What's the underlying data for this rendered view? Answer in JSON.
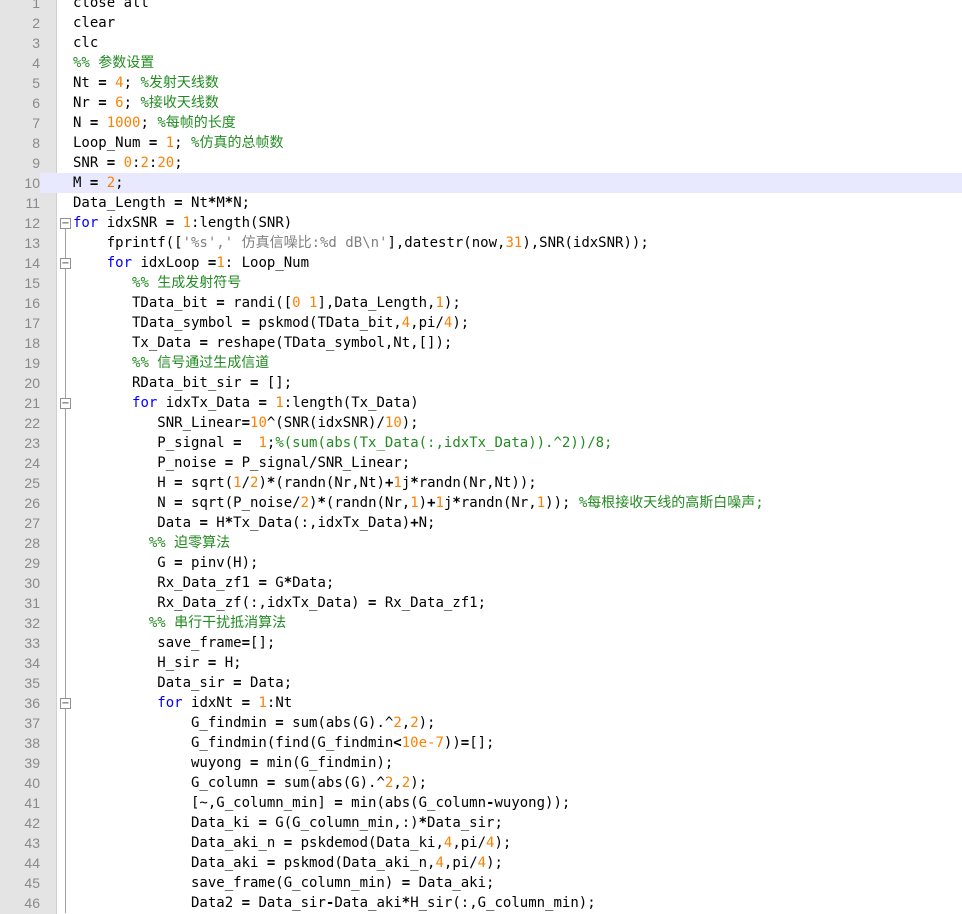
{
  "editor": {
    "highlight_line": 10,
    "colors": {
      "background": "#ffffff",
      "gutter": "#e4e4e4",
      "current_line": "#e8e8ff",
      "keyword": "#0000ff",
      "comment": "#228b22",
      "number": "#ff8000",
      "string": "#808080",
      "line_number": "#8a8a8a"
    },
    "lines": [
      {
        "n": "1",
        "fold": "",
        "tokens": [
          [
            "t",
            "close all"
          ]
        ]
      },
      {
        "n": "2",
        "fold": "",
        "tokens": [
          [
            "t",
            "clear"
          ]
        ]
      },
      {
        "n": "3",
        "fold": "",
        "tokens": [
          [
            "t",
            "clc"
          ]
        ]
      },
      {
        "n": "4",
        "fold": "",
        "tokens": [
          [
            "c",
            "%% 参数设置"
          ]
        ]
      },
      {
        "n": "5",
        "fold": "",
        "tokens": [
          [
            "t",
            "Nt "
          ],
          [
            "o",
            "="
          ],
          [
            "t",
            " "
          ],
          [
            "n",
            "4"
          ],
          [
            "t",
            "; "
          ],
          [
            "c",
            "%发射天线数"
          ]
        ]
      },
      {
        "n": "6",
        "fold": "",
        "tokens": [
          [
            "t",
            "Nr "
          ],
          [
            "o",
            "="
          ],
          [
            "t",
            " "
          ],
          [
            "n",
            "6"
          ],
          [
            "t",
            "; "
          ],
          [
            "c",
            "%接收天线数"
          ]
        ]
      },
      {
        "n": "7",
        "fold": "",
        "tokens": [
          [
            "t",
            "N "
          ],
          [
            "o",
            "="
          ],
          [
            "t",
            " "
          ],
          [
            "n",
            "1000"
          ],
          [
            "t",
            "; "
          ],
          [
            "c",
            "%每帧的长度"
          ]
        ]
      },
      {
        "n": "8",
        "fold": "",
        "tokens": [
          [
            "t",
            "Loop_Num "
          ],
          [
            "o",
            "="
          ],
          [
            "t",
            " "
          ],
          [
            "n",
            "1"
          ],
          [
            "t",
            "; "
          ],
          [
            "c",
            "%仿真的总帧数"
          ]
        ]
      },
      {
        "n": "9",
        "fold": "",
        "tokens": [
          [
            "t",
            "SNR "
          ],
          [
            "o",
            "="
          ],
          [
            "t",
            " "
          ],
          [
            "n",
            "0"
          ],
          [
            "t",
            ":"
          ],
          [
            "n",
            "2"
          ],
          [
            "t",
            ":"
          ],
          [
            "n",
            "20"
          ],
          [
            "t",
            ";"
          ]
        ]
      },
      {
        "n": "10",
        "fold": "",
        "tokens": [
          [
            "t",
            "M "
          ],
          [
            "o",
            "="
          ],
          [
            "t",
            " "
          ],
          [
            "n",
            "2"
          ],
          [
            "t",
            ";"
          ]
        ]
      },
      {
        "n": "11",
        "fold": "",
        "tokens": [
          [
            "t",
            "Data_Length "
          ],
          [
            "o",
            "="
          ],
          [
            "t",
            " Nt"
          ],
          [
            "o",
            "*"
          ],
          [
            "t",
            "M"
          ],
          [
            "o",
            "*"
          ],
          [
            "t",
            "N;"
          ]
        ]
      },
      {
        "n": "12",
        "fold": "open-top",
        "tokens": [
          [
            "k",
            "for"
          ],
          [
            "t",
            " idxSNR "
          ],
          [
            "o",
            "="
          ],
          [
            "t",
            " "
          ],
          [
            "n",
            "1"
          ],
          [
            "t",
            ":length(SNR)"
          ]
        ]
      },
      {
        "n": "13",
        "fold": "line",
        "tokens": [
          [
            "t",
            "    fprintf(["
          ],
          [
            "s",
            "'%s',' 仿真信噪比:%d dB\\n'"
          ],
          [
            "t",
            "],datestr(now,"
          ],
          [
            "n",
            "31"
          ],
          [
            "t",
            "),SNR(idxSNR));"
          ]
        ]
      },
      {
        "n": "14",
        "fold": "open",
        "tokens": [
          [
            "t",
            "    "
          ],
          [
            "k",
            "for"
          ],
          [
            "t",
            " idxLoop "
          ],
          [
            "o",
            "="
          ],
          [
            "n",
            "1"
          ],
          [
            "t",
            ": Loop_Num"
          ]
        ]
      },
      {
        "n": "15",
        "fold": "line",
        "tokens": [
          [
            "t",
            "       "
          ],
          [
            "c",
            "%% 生成发射符号"
          ]
        ]
      },
      {
        "n": "16",
        "fold": "line",
        "tokens": [
          [
            "t",
            "       TData_bit "
          ],
          [
            "o",
            "="
          ],
          [
            "t",
            " randi(["
          ],
          [
            "n",
            "0 1"
          ],
          [
            "t",
            "],Data_Length,"
          ],
          [
            "n",
            "1"
          ],
          [
            "t",
            ");"
          ]
        ]
      },
      {
        "n": "17",
        "fold": "line",
        "tokens": [
          [
            "t",
            "       TData_symbol "
          ],
          [
            "o",
            "="
          ],
          [
            "t",
            " pskmod(TData_bit,"
          ],
          [
            "n",
            "4"
          ],
          [
            "t",
            ",pi/"
          ],
          [
            "n",
            "4"
          ],
          [
            "t",
            ");"
          ]
        ]
      },
      {
        "n": "18",
        "fold": "line",
        "tokens": [
          [
            "t",
            "       Tx_Data "
          ],
          [
            "o",
            "="
          ],
          [
            "t",
            " reshape(TData_symbol,Nt,[]);"
          ]
        ]
      },
      {
        "n": "19",
        "fold": "line",
        "tokens": [
          [
            "t",
            "       "
          ],
          [
            "c",
            "%% 信号通过生成信道"
          ]
        ]
      },
      {
        "n": "20",
        "fold": "line",
        "tokens": [
          [
            "t",
            "       RData_bit_sir "
          ],
          [
            "o",
            "="
          ],
          [
            "t",
            " [];"
          ]
        ]
      },
      {
        "n": "21",
        "fold": "open",
        "tokens": [
          [
            "t",
            "       "
          ],
          [
            "k",
            "for"
          ],
          [
            "t",
            " idxTx_Data "
          ],
          [
            "o",
            "="
          ],
          [
            "t",
            " "
          ],
          [
            "n",
            "1"
          ],
          [
            "t",
            ":length(Tx_Data)"
          ]
        ]
      },
      {
        "n": "22",
        "fold": "line",
        "tokens": [
          [
            "t",
            "          SNR_Linear"
          ],
          [
            "o",
            "="
          ],
          [
            "n",
            "10"
          ],
          [
            "t",
            "^(SNR(idxSNR)/"
          ],
          [
            "n",
            "10"
          ],
          [
            "t",
            ");"
          ]
        ]
      },
      {
        "n": "23",
        "fold": "line",
        "tokens": [
          [
            "t",
            "          P_signal "
          ],
          [
            "o",
            "="
          ],
          [
            "t",
            "  "
          ],
          [
            "n",
            "1"
          ],
          [
            "t",
            ";"
          ],
          [
            "c",
            "%(sum(abs(Tx_Data(:,idxTx_Data)).^2))/8;"
          ]
        ]
      },
      {
        "n": "24",
        "fold": "line",
        "tokens": [
          [
            "t",
            "          P_noise "
          ],
          [
            "o",
            "="
          ],
          [
            "t",
            " P_signal/SNR_Linear;"
          ]
        ]
      },
      {
        "n": "25",
        "fold": "line",
        "tokens": [
          [
            "t",
            "          H "
          ],
          [
            "o",
            "="
          ],
          [
            "t",
            " sqrt("
          ],
          [
            "n",
            "1"
          ],
          [
            "t",
            "/"
          ],
          [
            "n",
            "2"
          ],
          [
            "t",
            ")"
          ],
          [
            "o",
            "*"
          ],
          [
            "t",
            "(randn(Nr,Nt)"
          ],
          [
            "o",
            "+"
          ],
          [
            "n",
            "1"
          ],
          [
            "t",
            "j"
          ],
          [
            "o",
            "*"
          ],
          [
            "t",
            "randn(Nr,Nt));"
          ]
        ]
      },
      {
        "n": "26",
        "fold": "line",
        "tokens": [
          [
            "t",
            "          N "
          ],
          [
            "o",
            "="
          ],
          [
            "t",
            " sqrt(P_noise/"
          ],
          [
            "n",
            "2"
          ],
          [
            "t",
            ")"
          ],
          [
            "o",
            "*"
          ],
          [
            "t",
            "(randn(Nr,"
          ],
          [
            "n",
            "1"
          ],
          [
            "t",
            ")"
          ],
          [
            "o",
            "+"
          ],
          [
            "n",
            "1"
          ],
          [
            "t",
            "j"
          ],
          [
            "o",
            "*"
          ],
          [
            "t",
            "randn(Nr,"
          ],
          [
            "n",
            "1"
          ],
          [
            "t",
            "));"
          ],
          [
            "t",
            " "
          ],
          [
            "c",
            "%每根接收天线的高斯白噪声;"
          ]
        ]
      },
      {
        "n": "27",
        "fold": "line",
        "tokens": [
          [
            "t",
            "          Data "
          ],
          [
            "o",
            "="
          ],
          [
            "t",
            " H"
          ],
          [
            "o",
            "*"
          ],
          [
            "t",
            "Tx_Data(:,idxTx_Data)"
          ],
          [
            "o",
            "+"
          ],
          [
            "t",
            "N;"
          ]
        ]
      },
      {
        "n": "28",
        "fold": "line",
        "tokens": [
          [
            "t",
            "         "
          ],
          [
            "c",
            "%% 迫零算法"
          ]
        ]
      },
      {
        "n": "29",
        "fold": "line",
        "tokens": [
          [
            "t",
            "          G "
          ],
          [
            "o",
            "="
          ],
          [
            "t",
            " pinv(H);"
          ]
        ]
      },
      {
        "n": "30",
        "fold": "line",
        "tokens": [
          [
            "t",
            "          Rx_Data_zf1 "
          ],
          [
            "o",
            "="
          ],
          [
            "t",
            " G"
          ],
          [
            "o",
            "*"
          ],
          [
            "t",
            "Data;"
          ]
        ]
      },
      {
        "n": "31",
        "fold": "line",
        "tokens": [
          [
            "t",
            "          Rx_Data_zf(:,idxTx_Data) "
          ],
          [
            "o",
            "="
          ],
          [
            "t",
            " Rx_Data_zf1;"
          ]
        ]
      },
      {
        "n": "32",
        "fold": "line",
        "tokens": [
          [
            "t",
            "         "
          ],
          [
            "c",
            "%% 串行干扰抵消算法"
          ]
        ]
      },
      {
        "n": "33",
        "fold": "line",
        "tokens": [
          [
            "t",
            "          save_frame"
          ],
          [
            "o",
            "="
          ],
          [
            "t",
            "[];"
          ]
        ]
      },
      {
        "n": "34",
        "fold": "line",
        "tokens": [
          [
            "t",
            "          H_sir "
          ],
          [
            "o",
            "="
          ],
          [
            "t",
            " H;"
          ]
        ]
      },
      {
        "n": "35",
        "fold": "line",
        "tokens": [
          [
            "t",
            "          Data_sir "
          ],
          [
            "o",
            "="
          ],
          [
            "t",
            " Data;"
          ]
        ]
      },
      {
        "n": "36",
        "fold": "open",
        "tokens": [
          [
            "t",
            "          "
          ],
          [
            "k",
            "for"
          ],
          [
            "t",
            " idxNt "
          ],
          [
            "o",
            "="
          ],
          [
            "t",
            " "
          ],
          [
            "n",
            "1"
          ],
          [
            "t",
            ":Nt"
          ]
        ]
      },
      {
        "n": "37",
        "fold": "line",
        "tokens": [
          [
            "t",
            "              G_findmin "
          ],
          [
            "o",
            "="
          ],
          [
            "t",
            " sum(abs(G).^"
          ],
          [
            "n",
            "2"
          ],
          [
            "t",
            ","
          ],
          [
            "n",
            "2"
          ],
          [
            "t",
            ");"
          ]
        ]
      },
      {
        "n": "38",
        "fold": "line",
        "tokens": [
          [
            "t",
            "              G_findmin(find(G_findmin"
          ],
          [
            "o",
            "<"
          ],
          [
            "n",
            "10e-7"
          ],
          [
            "t",
            "))"
          ],
          [
            "o",
            "="
          ],
          [
            "t",
            "[];"
          ]
        ]
      },
      {
        "n": "39",
        "fold": "line",
        "tokens": [
          [
            "t",
            "              wuyong "
          ],
          [
            "o",
            "="
          ],
          [
            "t",
            " min(G_findmin);"
          ]
        ]
      },
      {
        "n": "40",
        "fold": "line",
        "tokens": [
          [
            "t",
            "              G_column "
          ],
          [
            "o",
            "="
          ],
          [
            "t",
            " sum(abs(G).^"
          ],
          [
            "n",
            "2"
          ],
          [
            "t",
            ","
          ],
          [
            "n",
            "2"
          ],
          [
            "t",
            ");"
          ]
        ]
      },
      {
        "n": "41",
        "fold": "line",
        "tokens": [
          [
            "t",
            "              [~,G_column_min] "
          ],
          [
            "o",
            "="
          ],
          [
            "t",
            " min(abs(G_column"
          ],
          [
            "o",
            "-"
          ],
          [
            "t",
            "wuyong));"
          ]
        ]
      },
      {
        "n": "42",
        "fold": "line",
        "tokens": [
          [
            "t",
            "              Data_ki "
          ],
          [
            "o",
            "="
          ],
          [
            "t",
            " G(G_column_min,:)"
          ],
          [
            "o",
            "*"
          ],
          [
            "t",
            "Data_sir;"
          ]
        ]
      },
      {
        "n": "43",
        "fold": "line",
        "tokens": [
          [
            "t",
            "              Data_aki_n "
          ],
          [
            "o",
            "="
          ],
          [
            "t",
            " pskdemod(Data_ki,"
          ],
          [
            "n",
            "4"
          ],
          [
            "t",
            ",pi/"
          ],
          [
            "n",
            "4"
          ],
          [
            "t",
            ");"
          ]
        ]
      },
      {
        "n": "44",
        "fold": "line",
        "tokens": [
          [
            "t",
            "              Data_aki "
          ],
          [
            "o",
            "="
          ],
          [
            "t",
            " pskmod(Data_aki_n,"
          ],
          [
            "n",
            "4"
          ],
          [
            "t",
            ",pi/"
          ],
          [
            "n",
            "4"
          ],
          [
            "t",
            ");"
          ]
        ]
      },
      {
        "n": "45",
        "fold": "line",
        "tokens": [
          [
            "t",
            "              save_frame(G_column_min) "
          ],
          [
            "o",
            "="
          ],
          [
            "t",
            " Data_aki;"
          ]
        ]
      },
      {
        "n": "46",
        "fold": "line",
        "tokens": [
          [
            "t",
            "              Data2 "
          ],
          [
            "o",
            "="
          ],
          [
            "t",
            " Data_sir"
          ],
          [
            "o",
            "-"
          ],
          [
            "t",
            "Data_aki"
          ],
          [
            "o",
            "*"
          ],
          [
            "t",
            "H_sir(:,G_column_min);"
          ]
        ]
      }
    ]
  }
}
